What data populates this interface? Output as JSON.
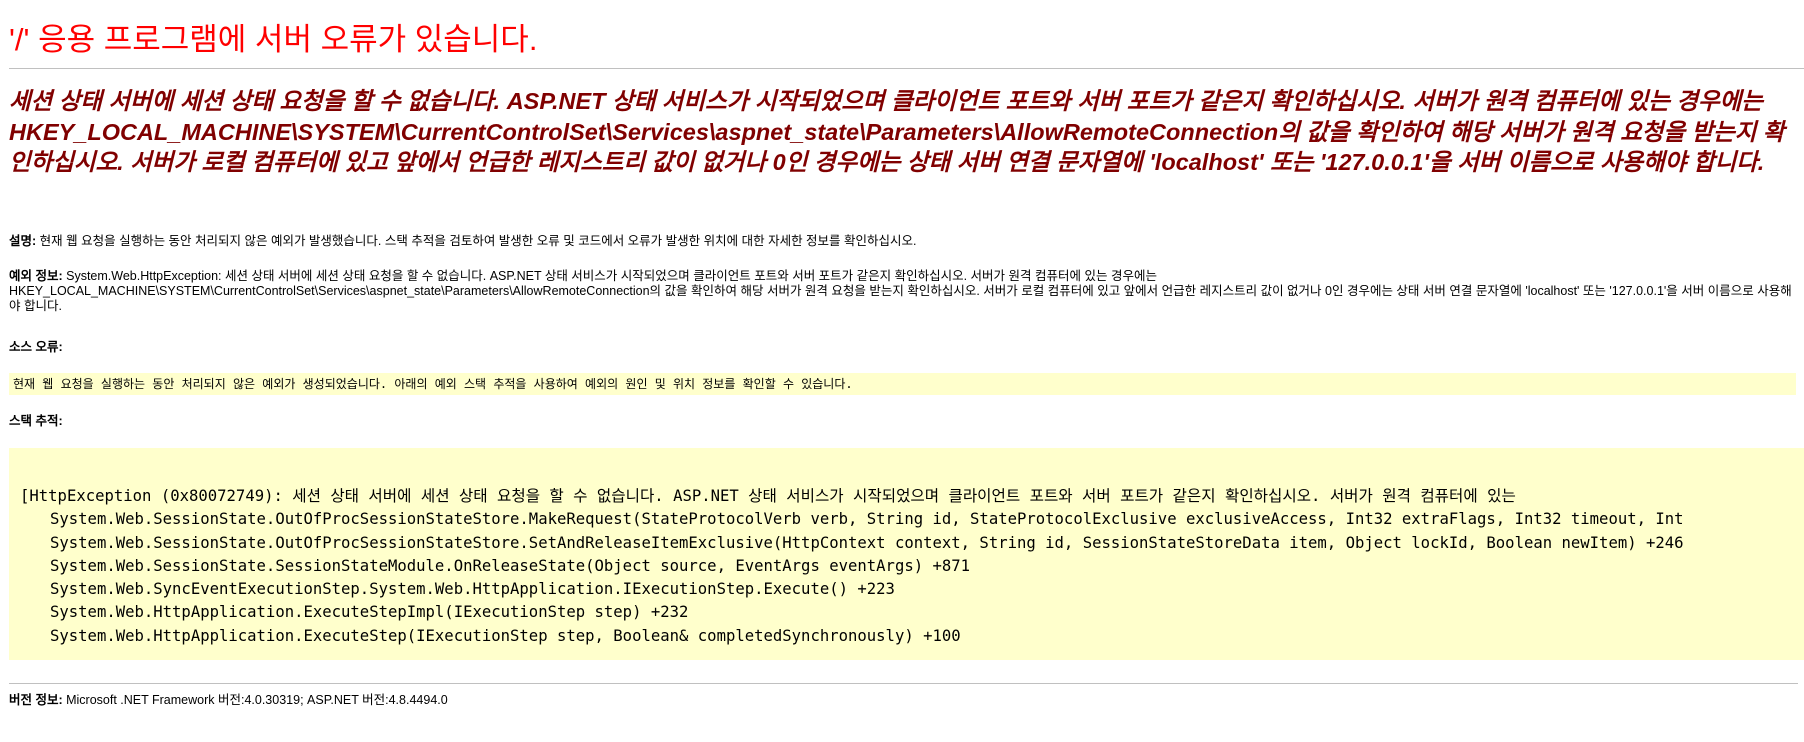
{
  "page": {
    "title": "'/' 응용 프로그램에 서버 오류가 있습니다.",
    "subtitle": "세션 상태 서버에 세션 상태 요청을 할 수 없습니다. ASP.NET 상태 서비스가 시작되었으며 클라이언트 포트와 서버 포트가 같은지 확인하십시오. 서버가 원격 컴퓨터에 있는 경우에는 HKEY_LOCAL_MACHINE\\SYSTEM\\CurrentControlSet\\Services\\aspnet_state\\Parameters\\AllowRemoteConnection의 값을 확인하여 해당 서버가 원격 요청을 받는지 확인하십시오. 서버가 로컬 컴퓨터에 있고 앞에서 언급한 레지스트리 값이 없거나 0인 경우에는 상태 서버 연결 문자열에 'localhost' 또는 '127.0.0.1'을 서버 이름으로 사용해야 합니다."
  },
  "description": {
    "label": "설명:",
    "text": " 현재 웹 요청을 실행하는 동안 처리되지 않은 예외가 발생했습니다. 스택 추적을 검토하여 발생한 오류 및 코드에서 오류가 발생한 위치에 대한 자세한 정보를 확인하십시오."
  },
  "exception": {
    "label": "예외 정보:",
    "text": " System.Web.HttpException: 세션 상태 서버에 세션 상태 요청을 할 수 없습니다. ASP.NET 상태 서비스가 시작되었으며 클라이언트 포트와 서버 포트가 같은지 확인하십시오. 서버가 원격 컴퓨터에 있는 경우에는 HKEY_LOCAL_MACHINE\\SYSTEM\\CurrentControlSet\\Services\\aspnet_state\\Parameters\\AllowRemoteConnection의 값을 확인하여 해당 서버가 원격 요청을 받는지 확인하십시오. 서버가 로컬 컴퓨터에 있고 앞에서 언급한 레지스트리 값이 없거나 0인 경우에는 상태 서버 연결 문자열에 'localhost' 또는 '127.0.0.1'을 서버 이름으로 사용해야 합니다."
  },
  "source_error": {
    "label": "소스 오류:",
    "text": "현재 웹 요청을 실행하는 동안 처리되지 않은 예외가 생성되었습니다. 아래의 예외 스택 추적을 사용하여 예외의 원인 및 위치 정보를 확인할 수 있습니다."
  },
  "stack_trace": {
    "label": "스택 추적:",
    "header": "[HttpException (0x80072749): 세션 상태 서버에 세션 상태 요청을 할 수 없습니다. ASP.NET 상태 서비스가 시작되었으며 클라이언트 포트와 서버 포트가 같은지 확인하십시오. 서버가 원격 컴퓨터에 있는",
    "frames": [
      "System.Web.SessionState.OutOfProcSessionStateStore.MakeRequest(StateProtocolVerb verb, String id, StateProtocolExclusive exclusiveAccess, Int32 extraFlags, Int32 timeout, Int",
      "System.Web.SessionState.OutOfProcSessionStateStore.SetAndReleaseItemExclusive(HttpContext context, String id, SessionStateStoreData item, Object lockId, Boolean newItem) +246",
      "System.Web.SessionState.SessionStateModule.OnReleaseState(Object source, EventArgs eventArgs) +871",
      "System.Web.SyncEventExecutionStep.System.Web.HttpApplication.IExecutionStep.Execute() +223",
      "System.Web.HttpApplication.ExecuteStepImpl(IExecutionStep step) +232",
      "System.Web.HttpApplication.ExecuteStep(IExecutionStep step, Boolean& completedSynchronously) +100"
    ]
  },
  "version_info": {
    "label": "버전 정보:",
    "text": " Microsoft .NET Framework 버전:4.0.30319; ASP.NET 버전:4.8.4494.0"
  },
  "colors": {
    "title": "#ff0000",
    "subtitle": "#800000",
    "code_background": "#ffffcc",
    "rule": "#c0c0c0"
  }
}
